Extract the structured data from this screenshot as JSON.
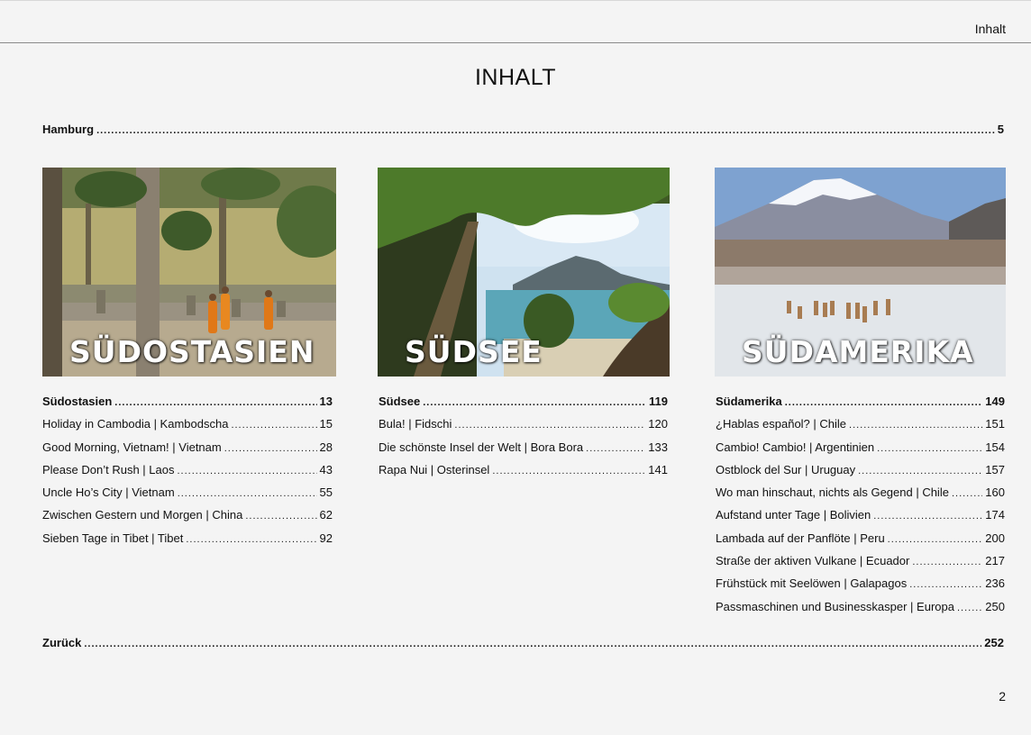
{
  "header": {
    "section_label": "Inhalt"
  },
  "title": "INHALT",
  "top_entry": {
    "label": "Hamburg",
    "page": "5"
  },
  "regions": [
    {
      "caption": "SÜDOSTASIEN",
      "heading": {
        "label": "Südostasien",
        "page": "13"
      },
      "entries": [
        {
          "label": "Holiday in Cambodia | Kambodscha",
          "page": "15"
        },
        {
          "label": "Good Morning, Vietnam! | Vietnam",
          "page": "28"
        },
        {
          "label": "Please Don’t Rush | Laos",
          "page": "43"
        },
        {
          "label": "Uncle Ho’s City | Vietnam",
          "page": "55"
        },
        {
          "label": "Zwischen Gestern und Morgen | China",
          "page": "62"
        },
        {
          "label": "Sieben Tage in Tibet | Tibet",
          "page": "92"
        }
      ]
    },
    {
      "caption": "SÜDSEE",
      "heading": {
        "label": "Südsee",
        "page": "119"
      },
      "entries": [
        {
          "label": "Bula! | Fidschi",
          "page": "120"
        },
        {
          "label": "Die schönste Insel der Welt | Bora Bora",
          "page": "133"
        },
        {
          "label": "Rapa Nui | Osterinsel",
          "page": "141"
        }
      ]
    },
    {
      "caption": "SÜDAMERIKA",
      "heading": {
        "label": "Südamerika",
        "page": "149"
      },
      "entries": [
        {
          "label": "¿Hablas español? | Chile",
          "page": "151"
        },
        {
          "label": "Cambio! Cambio! | Argentinien",
          "page": "154"
        },
        {
          "label": "Ostblock del Sur | Uruguay",
          "page": "157"
        },
        {
          "label": "Wo man hinschaut, nichts als Gegend | Chile",
          "page": "160"
        },
        {
          "label": "Aufstand unter Tage | Bolivien",
          "page": "174"
        },
        {
          "label": "Lambada auf der Panflöte | Peru",
          "page": "200"
        },
        {
          "label": "Straße der aktiven Vulkane | Ecuador",
          "page": "217"
        },
        {
          "label": "Frühstück mit Seelöwen | Galapagos",
          "page": "236"
        },
        {
          "label": "Passmaschinen und Businesskasper | Europa",
          "page": "250"
        }
      ]
    }
  ],
  "bottom_entry": {
    "label": "Zurück",
    "page": "252"
  },
  "page_number": "2"
}
